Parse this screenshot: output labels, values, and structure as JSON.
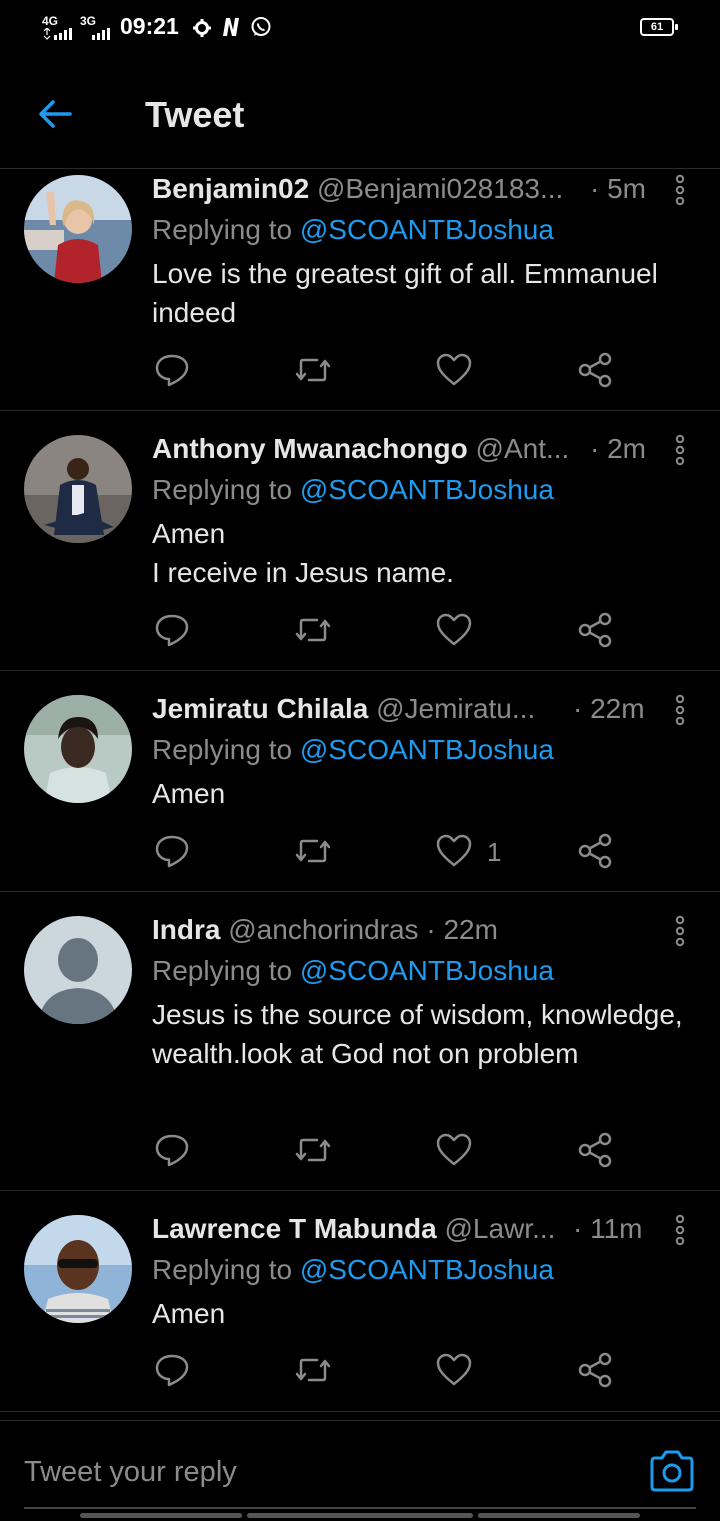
{
  "status_bar": {
    "net1": "4G",
    "net2": "3G",
    "time": "09:21",
    "battery": "61"
  },
  "header": {
    "title": "Tweet"
  },
  "tweets": [
    {
      "name": "Benjamin02",
      "handle": "@Benjami028183...",
      "ago": "· 5m",
      "replying_prefix": "Replying to ",
      "replying_to": "@SCOANTBJoshua",
      "text": "Love is the greatest gift of all. Emmanuel indeed",
      "likes": ""
    },
    {
      "name": "Anthony Mwanachongo",
      "handle": "@Ant...",
      "ago": "· 2m",
      "replying_prefix": "Replying to ",
      "replying_to": "@SCOANTBJoshua",
      "text": "Amen\nI receive in Jesus name.",
      "likes": ""
    },
    {
      "name": "Jemiratu Chilala",
      "handle": "@Jemiratu...",
      "ago": "· 22m",
      "replying_prefix": "Replying to ",
      "replying_to": "@SCOANTBJoshua",
      "text": "Amen",
      "likes": "1"
    },
    {
      "name": "Indra",
      "handle": "@anchorindras",
      "ago": "· 22m",
      "replying_prefix": "Replying to ",
      "replying_to": "@SCOANTBJoshua",
      "text": "Jesus is the source of wisdom, knowledge, wealth.look at God not on problem",
      "likes": ""
    },
    {
      "name": "Lawrence T Mabunda",
      "handle": "@Lawr...",
      "ago": "· 11m",
      "replying_prefix": "Replying to ",
      "replying_to": "@SCOANTBJoshua",
      "text": "Amen",
      "likes": ""
    }
  ],
  "reply_bar": {
    "placeholder": "Tweet your reply"
  },
  "colors": {
    "accent": "#1d9bf0",
    "muted": "#8b8b8b",
    "text": "#e6e6e6",
    "background": "#000000"
  },
  "icons": [
    "back-arrow-icon",
    "reply-icon",
    "retweet-icon",
    "like-icon",
    "share-icon",
    "more-vertical-icon",
    "camera-icon"
  ]
}
